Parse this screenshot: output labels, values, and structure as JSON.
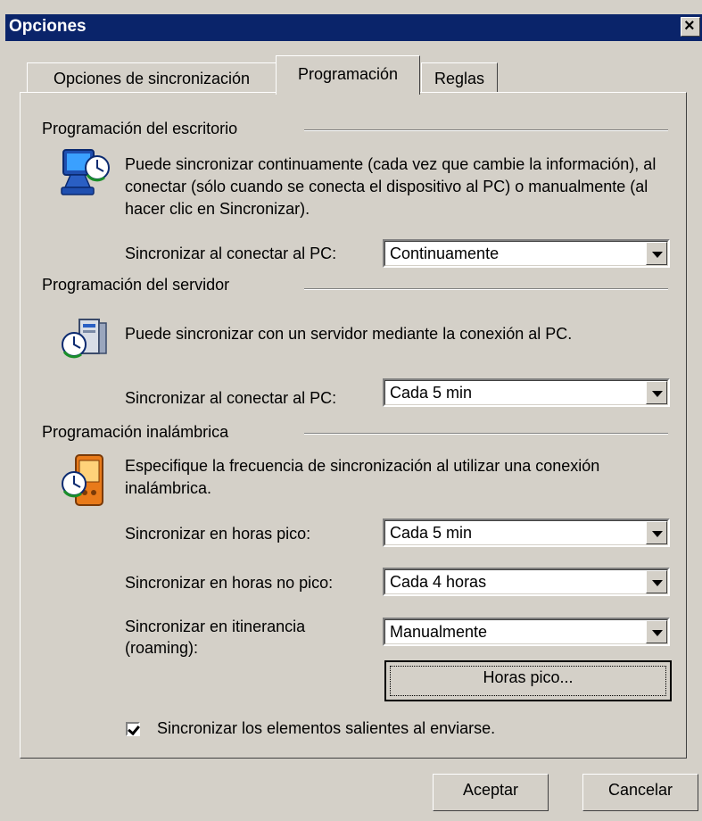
{
  "window": {
    "title": "Opciones",
    "close_label": "×"
  },
  "tabs": [
    {
      "label": "Opciones de sincronización"
    },
    {
      "label": "Programación"
    },
    {
      "label": "Reglas"
    }
  ],
  "desktop": {
    "heading": "Programación del escritorio",
    "description": "Puede sincronizar continuamente (cada vez que cambie la información), al conectar (sólo cuando se conecta el dispositivo al PC) o manualmente (al hacer clic en Sincronizar).",
    "label": "Sincronizar al conectar al PC:",
    "value": "Continuamente"
  },
  "server": {
    "heading": "Programación del servidor",
    "description": "Puede sincronizar con un servidor mediante la conexión al PC.",
    "label": "Sincronizar al conectar al PC:",
    "value": "Cada 5 min"
  },
  "wireless": {
    "heading": "Programación inalámbrica",
    "description": "Especifique la frecuencia de sincronización al utilizar una conexión inalámbrica.",
    "peak_label": "Sincronizar en horas pico:",
    "peak_value": "Cada 5 min",
    "offpeak_label": "Sincronizar en horas no pico:",
    "offpeak_value": "Cada 4 horas",
    "roaming_label_1": "Sincronizar en itinerancia",
    "roaming_label_2": "(roaming):",
    "roaming_value": "Manualmente",
    "peak_hours_button": "Horas pico..."
  },
  "outgoing_checkbox": {
    "label": "Sincronizar los elementos salientes al enviarse.",
    "checked": true
  },
  "buttons": {
    "ok": "Aceptar",
    "cancel": "Cancelar"
  },
  "icons": {
    "desktop": "pc-sync-icon",
    "server": "server-sync-icon",
    "wireless": "device-sync-icon"
  }
}
